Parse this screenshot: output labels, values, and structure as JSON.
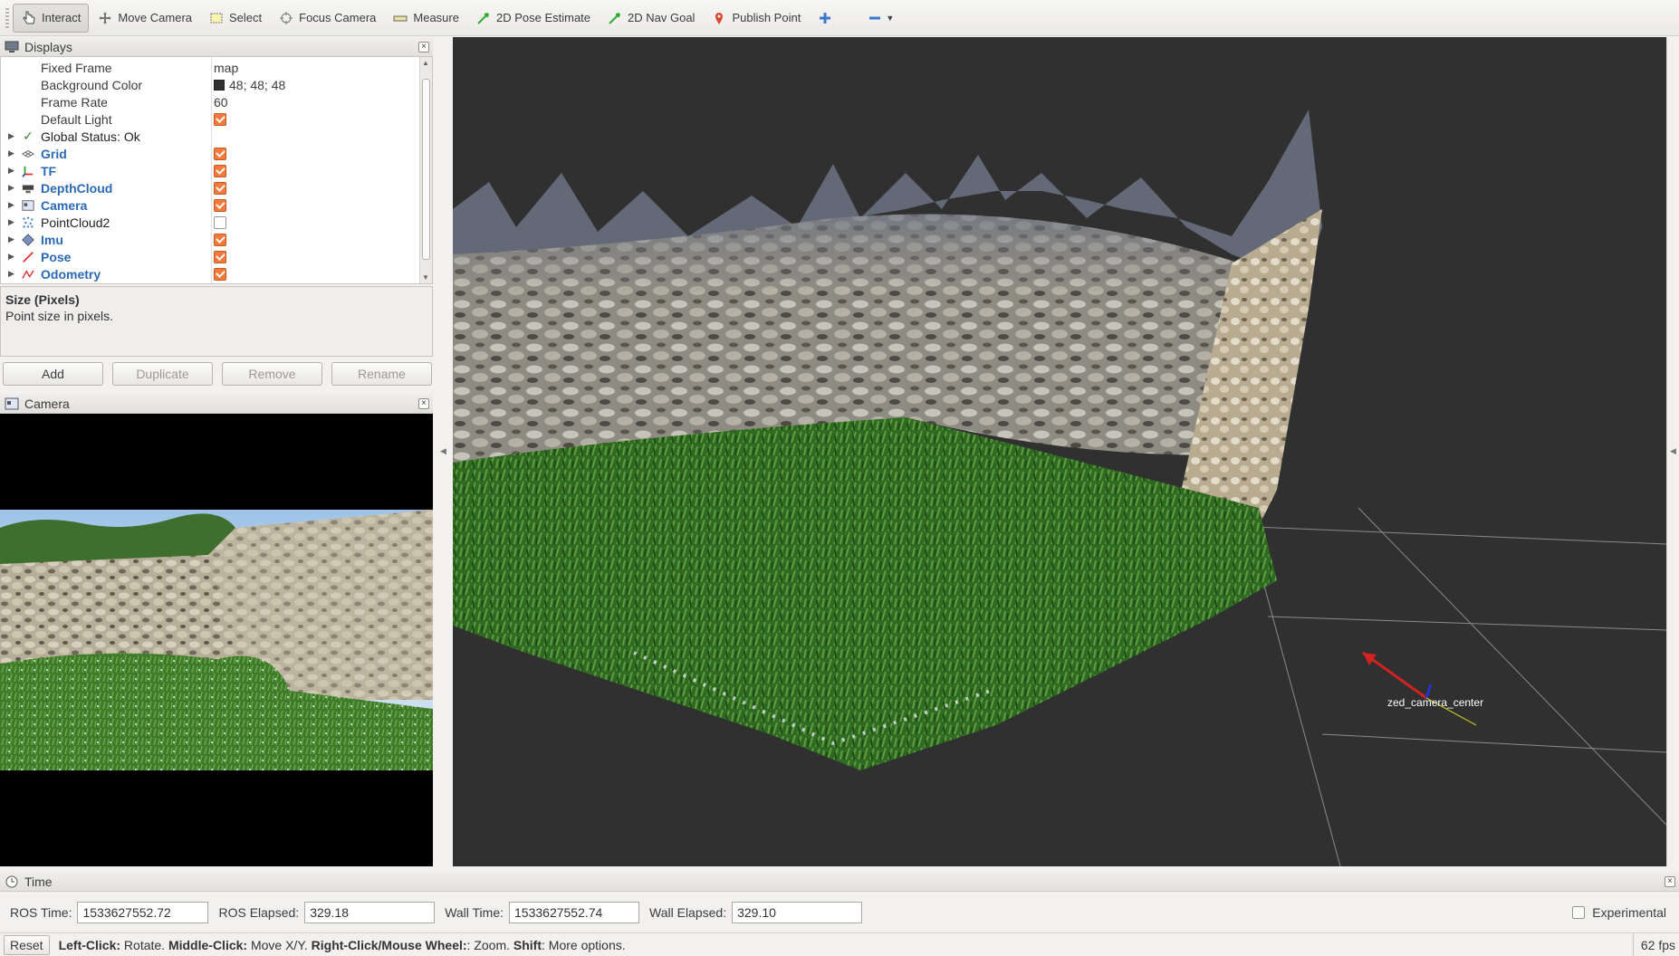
{
  "toolbar": {
    "tools": [
      {
        "label": "Interact",
        "icon": "hand-pointer-icon"
      },
      {
        "label": "Move Camera",
        "icon": "move-arrows-icon"
      },
      {
        "label": "Select",
        "icon": "select-rect-icon"
      },
      {
        "label": "Focus Camera",
        "icon": "focus-target-icon"
      },
      {
        "label": "Measure",
        "icon": "ruler-icon"
      },
      {
        "label": "2D Pose Estimate",
        "icon": "green-arrow-icon"
      },
      {
        "label": "2D Nav Goal",
        "icon": "green-arrow-icon"
      },
      {
        "label": "Publish Point",
        "icon": "map-pin-icon"
      }
    ]
  },
  "displays": {
    "title": "Displays",
    "rows": [
      {
        "name": "Fixed Frame",
        "value": "map"
      },
      {
        "name": "Background Color",
        "value": "48; 48; 48"
      },
      {
        "name": "Frame Rate",
        "value": "60"
      },
      {
        "name": "Default Light",
        "value": ""
      },
      {
        "name": "Global Status: Ok",
        "value": ""
      },
      {
        "name": "Grid",
        "value": ""
      },
      {
        "name": "TF",
        "value": ""
      },
      {
        "name": "DepthCloud",
        "value": ""
      },
      {
        "name": "Camera",
        "value": ""
      },
      {
        "name": "PointCloud2",
        "value": ""
      },
      {
        "name": "Imu",
        "value": ""
      },
      {
        "name": "Pose",
        "value": ""
      },
      {
        "name": "Odometry",
        "value": ""
      }
    ],
    "checked": {
      "default_light": true,
      "grid": true,
      "tf": true,
      "depthcloud": true,
      "camera": true,
      "pointcloud2": false,
      "imu": true,
      "pose": true,
      "odometry": true
    },
    "background_color_hex": "#303030",
    "description_title": "Size (Pixels)",
    "description_text": "Point size in pixels.",
    "buttons": {
      "add": "Add",
      "duplicate": "Duplicate",
      "remove": "Remove",
      "rename": "Rename"
    }
  },
  "camera_panel": {
    "title": "Camera"
  },
  "view3d": {
    "frame_label": "zed_camera_center"
  },
  "time": {
    "title": "Time",
    "ros_time_label": "ROS Time:",
    "ros_time": "1533627552.72",
    "ros_elapsed_label": "ROS Elapsed:",
    "ros_elapsed": "329.18",
    "wall_time_label": "Wall Time:",
    "wall_time": "1533627552.74",
    "wall_elapsed_label": "Wall Elapsed:",
    "wall_elapsed": "329.10",
    "experimental_label": "Experimental"
  },
  "status": {
    "reset_label": "Reset",
    "left_click": "Left-Click:",
    "left_click_desc": " Rotate. ",
    "middle_click": "Middle-Click:",
    "middle_click_desc": " Move X/Y. ",
    "right_click": "Right-Click/Mouse Wheel:",
    "right_click_desc": ": Zoom. ",
    "shift": "Shift",
    "shift_desc": ": More options.",
    "fps": "62 fps"
  },
  "colors": {
    "accent_check": "#f47a3c",
    "link_blue": "#2a69b8",
    "view_bg": "#303030"
  }
}
